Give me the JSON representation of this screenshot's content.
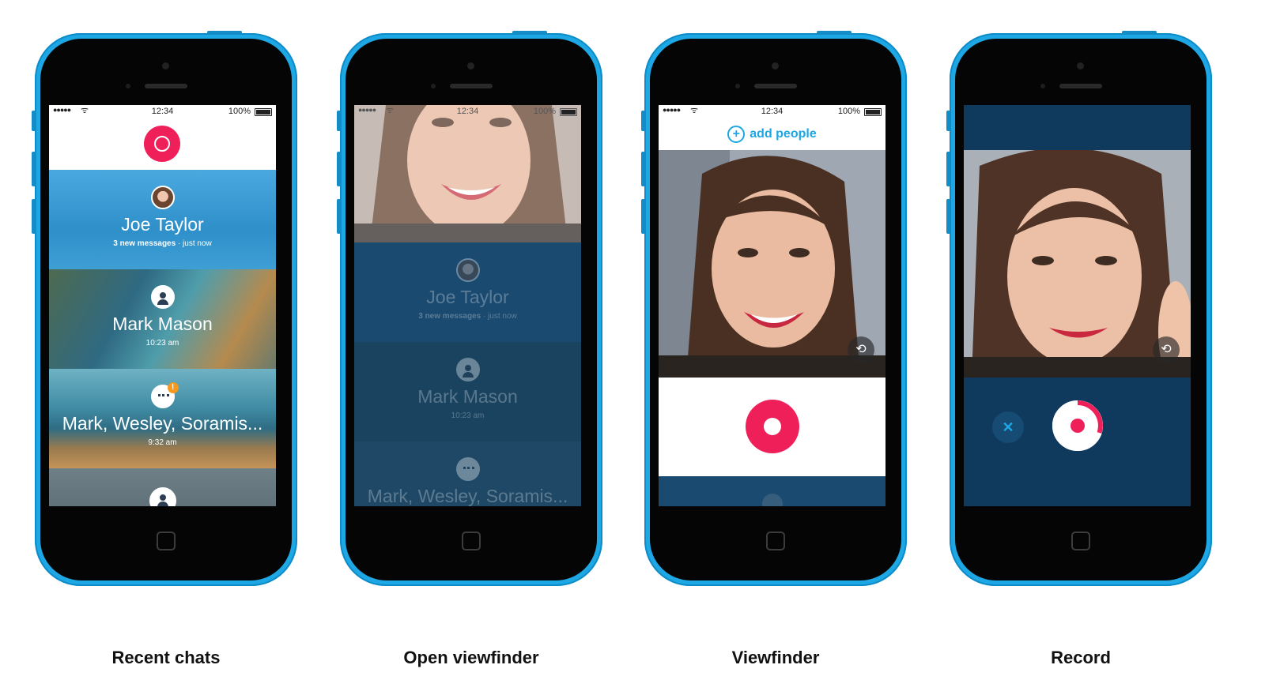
{
  "captions": [
    "Recent chats",
    "Open viewfinder",
    "Viewfinder",
    "Record"
  ],
  "status_bar": {
    "signal": "●●●●●",
    "wifi": "ᯤ",
    "time": "12:34",
    "battery_pct": "100%"
  },
  "chats": [
    {
      "name": "Joe Taylor",
      "detail_bold": "3 new messages",
      "detail_rest": " · just now"
    },
    {
      "name": "Mark Mason",
      "detail_bold": "",
      "detail_rest": "10:23 am"
    },
    {
      "name": "Mark, Wesley, Soramis...",
      "detail_bold": "",
      "detail_rest": "9:32 am"
    }
  ],
  "group_badge": "!",
  "add_people": {
    "icon": "+",
    "label": "add people"
  },
  "cancel_icon": "✕",
  "flip_icon": "⟲",
  "colors": {
    "phone": "#1da7e4",
    "accent": "#ef1f5a",
    "skype_blue": "#1da7e4",
    "dark_navy": "#0f3a5e"
  }
}
